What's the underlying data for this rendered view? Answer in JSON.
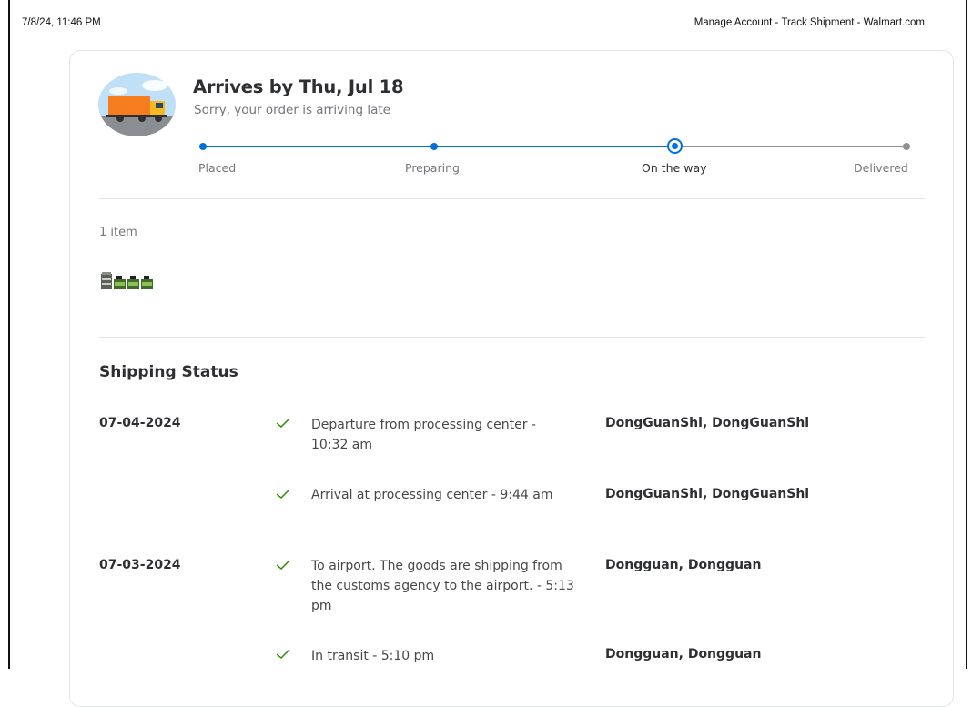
{
  "print_header": {
    "datetime": "7/8/24, 11:46 PM",
    "page_title": "Manage Account - Track Shipment - Walmart.com"
  },
  "arrival": {
    "title": "Arrives by Thu, Jul 18",
    "subtitle": "Sorry, your order is arriving late",
    "icon": "truck-icon"
  },
  "tracker": {
    "steps": [
      {
        "label": "Placed",
        "state": "complete"
      },
      {
        "label": "Preparing",
        "state": "complete"
      },
      {
        "label": "On the way",
        "state": "current"
      },
      {
        "label": "Delivered",
        "state": "pending"
      }
    ],
    "progress_color": "#0071dc",
    "pending_color": "#8e9093"
  },
  "items": {
    "count_label": "1 item",
    "thumbnail": "product-thumbnail"
  },
  "shipping_status": {
    "title": "Shipping Status",
    "check_color": "#2a8703",
    "rows": [
      {
        "date": "07-04-2024",
        "description": "Departure from processing center - 10:32 am",
        "location": "DongGuanShi, DongGuanShi"
      },
      {
        "date": "",
        "description": "Arrival at processing center - 9:44 am",
        "location": "DongGuanShi, DongGuanShi"
      },
      {
        "date": "07-03-2024",
        "description": "To airport. The goods are shipping from the customs agency to the airport. - 5:13 pm",
        "location": "Dongguan, Dongguan"
      },
      {
        "date": "",
        "description": "In transit - 5:10 pm",
        "location": "Dongguan, Dongguan"
      }
    ]
  }
}
